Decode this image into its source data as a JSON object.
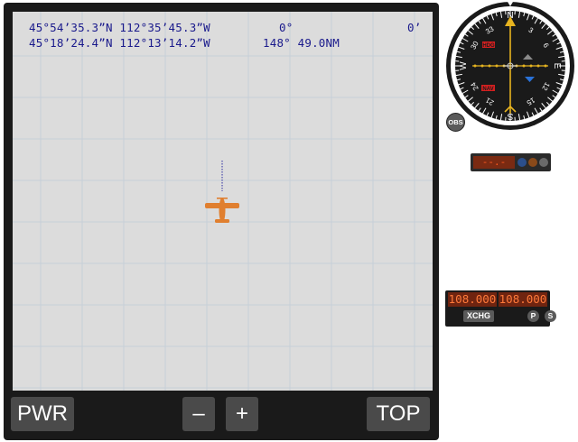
{
  "gps": {
    "row1": {
      "position": "45°54’35.3”N 112°35’45.3”W",
      "bearing": "0°",
      "distance": "0’"
    },
    "row2": {
      "position": "45°18’24.4”N 112°13’14.2”W",
      "bearing_distance": "148° 49.0NM"
    },
    "buttons": {
      "power": "PWR",
      "zoom_out": "–",
      "zoom_in": "+",
      "top": "TOP"
    },
    "colors": {
      "screen": "#dcdcdc",
      "readout_text": "#1a1a8c",
      "aircraft": "#e07f2f",
      "bezel": "#1a1a1a"
    }
  },
  "hsi": {
    "cardinals": {
      "north": "N",
      "east": "E",
      "south": "S",
      "west": "W"
    },
    "ticks": [
      "3",
      "6",
      "12",
      "15",
      "21",
      "24",
      "30",
      "33"
    ],
    "flags": {
      "heading": "HDG",
      "nav": "NAV"
    },
    "obs_label": "OBS"
  },
  "dme": {
    "display": "--.-"
  },
  "nav_radio": {
    "active": "108.000",
    "standby": "108.000",
    "xchg_label": "XCHG",
    "p_label": "P",
    "s_label": "S"
  }
}
